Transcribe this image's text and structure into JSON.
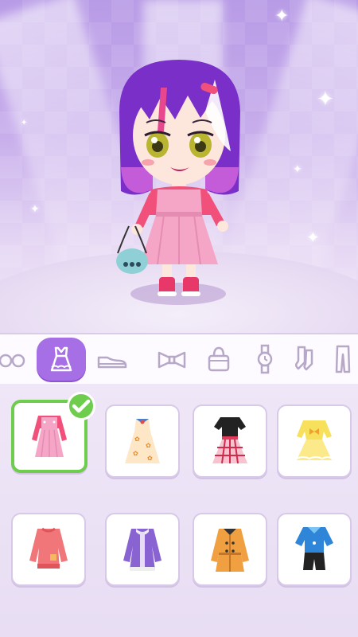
{
  "categories": [
    {
      "name": "glasses"
    },
    {
      "name": "dress"
    },
    {
      "name": "shoes"
    },
    {
      "name": "bow"
    },
    {
      "name": "bag"
    },
    {
      "name": "watch"
    },
    {
      "name": "socks"
    },
    {
      "name": "pants"
    }
  ],
  "active_category": "dress",
  "selected_item": "pink-pinafore-dress",
  "items": [
    {
      "name": "pink-pinafore-dress",
      "selected": true
    },
    {
      "name": "butterfly-print-dress",
      "selected": false
    },
    {
      "name": "plaid-skirt-dress",
      "selected": false
    },
    {
      "name": "yellow-bow-dress",
      "selected": false
    },
    {
      "name": "coral-sweater",
      "selected": false
    },
    {
      "name": "purple-fur-coat",
      "selected": false
    },
    {
      "name": "orange-trench-coat",
      "selected": false
    },
    {
      "name": "blue-top-outfit",
      "selected": false
    }
  ],
  "colors": {
    "accent": "#a66fe6",
    "selected_border": "#6ecd4c",
    "hair": "#7a2fc9",
    "dress": "#f5a6c6",
    "shirt": "#f0507a"
  }
}
